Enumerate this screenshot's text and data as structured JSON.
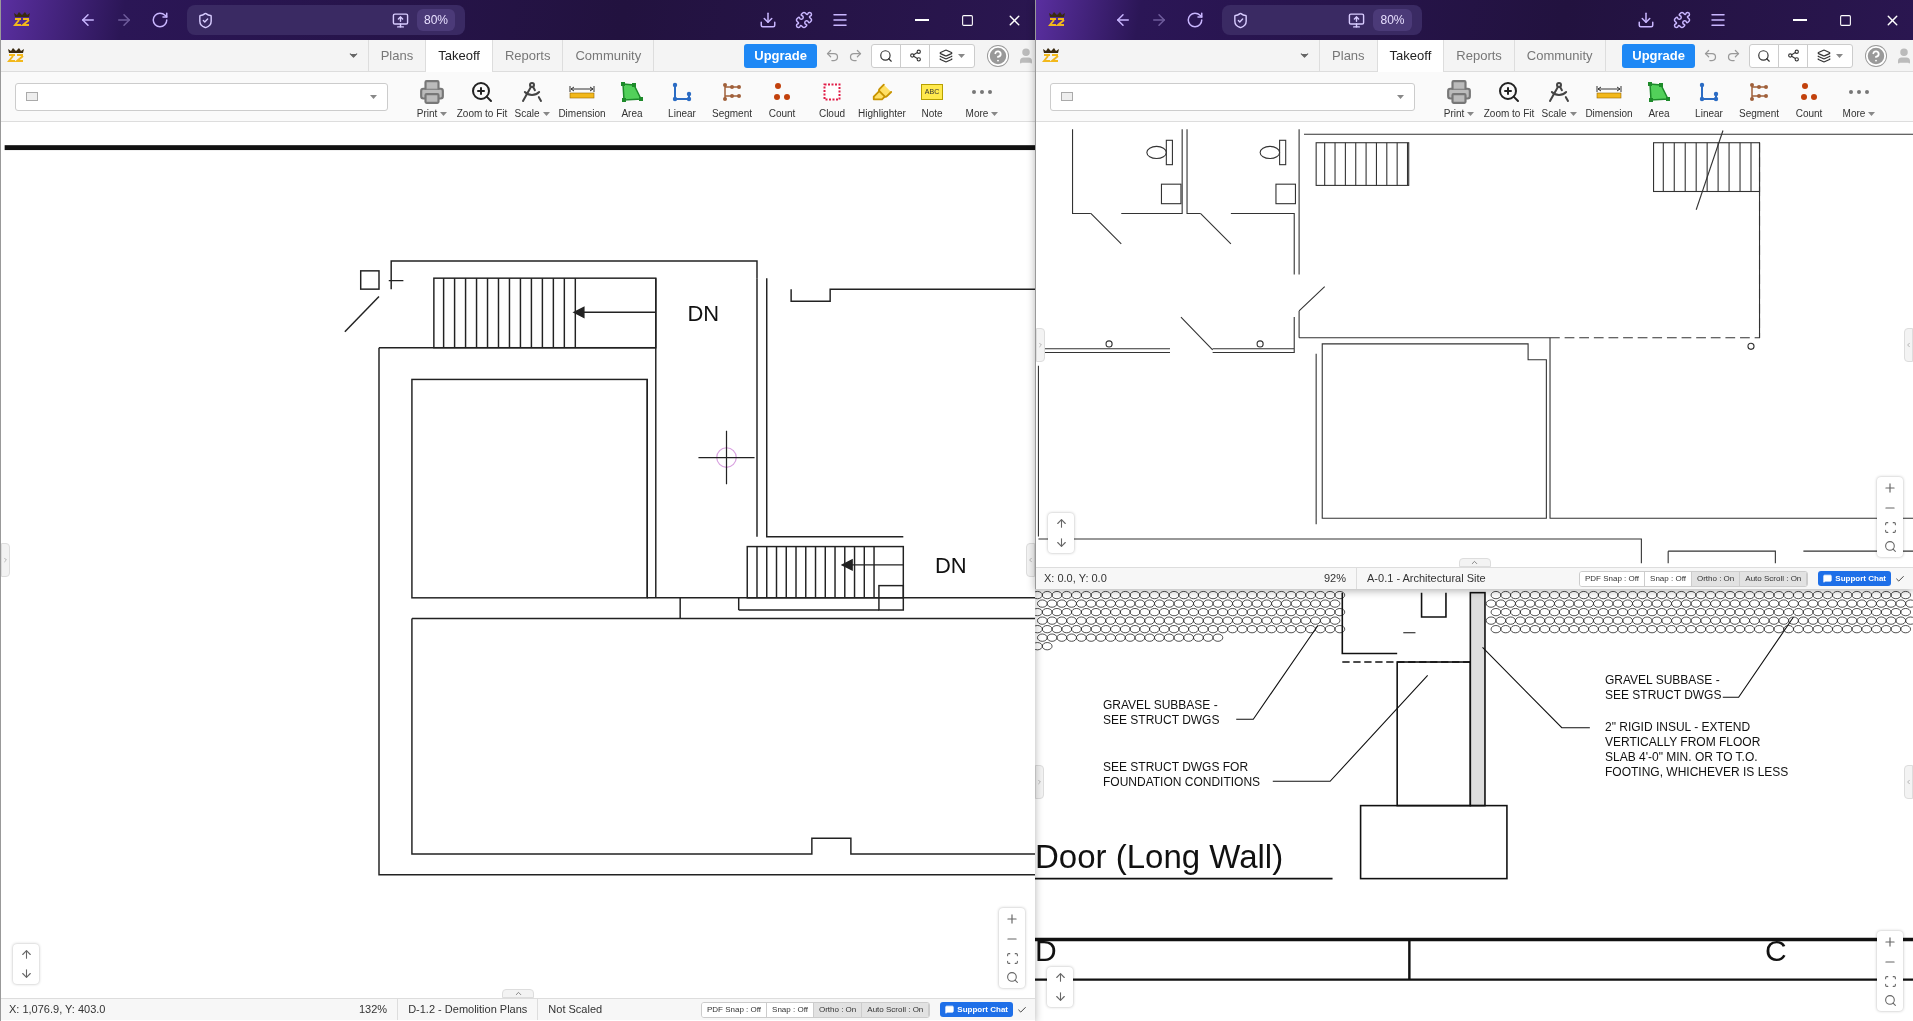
{
  "windows": [
    {
      "zoom": "80%",
      "forward_disabled": true,
      "tabs": [
        {
          "label": "Plans",
          "selected": false
        },
        {
          "label": "Takeoff",
          "selected": true
        },
        {
          "label": "Reports",
          "selected": false
        },
        {
          "label": "Community",
          "selected": false
        }
      ],
      "upgrade": "Upgrade",
      "tools": [
        {
          "label": "Print",
          "kind": "print",
          "menu": true
        },
        {
          "label": "Zoom to Fit",
          "kind": "zoom_fit",
          "menu": false
        },
        {
          "label": "Scale",
          "kind": "scale",
          "menu": true
        },
        {
          "label": "Dimension",
          "kind": "dimension",
          "menu": false
        },
        {
          "label": "Area",
          "kind": "area",
          "menu": false
        },
        {
          "label": "Linear",
          "kind": "linear",
          "menu": false
        },
        {
          "label": "Segment",
          "kind": "segment",
          "menu": false
        },
        {
          "label": "Count",
          "kind": "count",
          "menu": false
        },
        {
          "label": "Cloud",
          "kind": "cloud",
          "menu": false
        },
        {
          "label": "Highlighter",
          "kind": "highlighter",
          "menu": false
        },
        {
          "label": "Note",
          "kind": "note",
          "menu": false,
          "icon_text": "ABC"
        },
        {
          "label": "More",
          "kind": "more",
          "menu": true
        }
      ],
      "drawing": {
        "kind": "demolition_plan",
        "labels": [
          "DN",
          "DN"
        ]
      },
      "status": {
        "coords": "X: 1,076.9, Y: 403.0",
        "zoom": "132%",
        "sheet": "D-1.2 - Demolition Plans",
        "scale": "Not Scaled",
        "toggles": [
          {
            "label": "PDF Snap : Off",
            "on": false
          },
          {
            "label": "Snap : Off",
            "on": false
          },
          {
            "label": "Ortho : On",
            "on": true
          },
          {
            "label": "Auto Scroll : On",
            "on": true
          }
        ],
        "support": "Support Chat"
      }
    },
    {
      "zoom": "80%",
      "forward_disabled": true,
      "tabs": [
        {
          "label": "Plans",
          "selected": false
        },
        {
          "label": "Takeoff",
          "selected": true
        },
        {
          "label": "Reports",
          "selected": false
        },
        {
          "label": "Community",
          "selected": false
        }
      ],
      "upgrade": "Upgrade",
      "tools": [
        {
          "label": "Print",
          "kind": "print",
          "menu": true
        },
        {
          "label": "Zoom to Fit",
          "kind": "zoom_fit",
          "menu": false
        },
        {
          "label": "Scale",
          "kind": "scale",
          "menu": true
        },
        {
          "label": "Dimension",
          "kind": "dimension",
          "menu": false
        },
        {
          "label": "Area",
          "kind": "area",
          "menu": false
        },
        {
          "label": "Linear",
          "kind": "linear",
          "menu": false
        },
        {
          "label": "Segment",
          "kind": "segment",
          "menu": false
        },
        {
          "label": "Count",
          "kind": "count",
          "menu": false
        },
        {
          "label": "More",
          "kind": "more",
          "menu": true
        }
      ],
      "drawing": {
        "kind": "architectural_site"
      },
      "status": {
        "coords": "X: 0.0, Y: 0.0",
        "zoom": "92%",
        "sheet": "A-0.1 - Architectural Site",
        "toggles": [
          {
            "label": "PDF Snap : Off",
            "on": false
          },
          {
            "label": "Snap : Off",
            "on": false
          },
          {
            "label": "Ortho : On",
            "on": true
          },
          {
            "label": "Auto Scroll : On",
            "on": true
          }
        ],
        "support": "Support Chat"
      }
    }
  ],
  "detail_pane": {
    "notes": [
      "GRAVEL SUBBASE -\nSEE STRUCT DWGS",
      "SEE STRUCT DWGS FOR\nFOUNDATION CONDITIONS",
      "GRAVEL SUBBASE -\nSEE STRUCT DWGS",
      "2\" RIGID INSUL - EXTEND\nVERTICALLY FROM FLOOR\nSLAB 4'-0\" MIN. OR TO T.O.\nFOOTING, WHICHEVER IS LESS"
    ],
    "title": "Door (Long Wall)",
    "grid_labels": [
      "D",
      "C"
    ]
  }
}
